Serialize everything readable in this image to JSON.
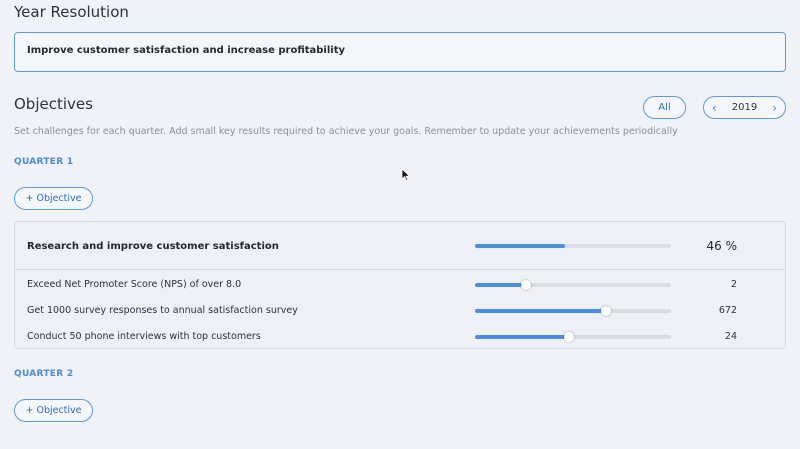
{
  "year_resolution": {
    "title": "Year Resolution",
    "value": "Improve customer satisfaction and increase profitability"
  },
  "objectives": {
    "title": "Objectives",
    "subtitle": "Set challenges for each quarter. Add small key results required to achieve your goals. Remember to update your achievements periodically",
    "filter_all_label": "All",
    "year_label": "2019",
    "prev_icon": "chevron-left-icon",
    "next_icon": "chevron-right-icon"
  },
  "quarters": [
    {
      "label": "QUARTER 1",
      "add_label": "+ Objective",
      "objective": {
        "title": "Research and improve customer satisfaction",
        "progress": 0.46,
        "percent_label": "46 %",
        "key_results": [
          {
            "label": "Exceed Net Promoter Score (NPS) of over 8.0",
            "progress": 0.26,
            "value": "2"
          },
          {
            "label": "Get 1000 survey responses to annual satisfaction survey",
            "progress": 0.67,
            "value": "672"
          },
          {
            "label": "Conduct 50 phone interviews with top customers",
            "progress": 0.48,
            "value": "24"
          }
        ]
      }
    },
    {
      "label": "QUARTER 2",
      "add_label": "+ Objective"
    }
  ],
  "colors": {
    "accent": "#4a8fe0",
    "border_accent": "#5b9be0",
    "background": "#f0f2f7"
  }
}
